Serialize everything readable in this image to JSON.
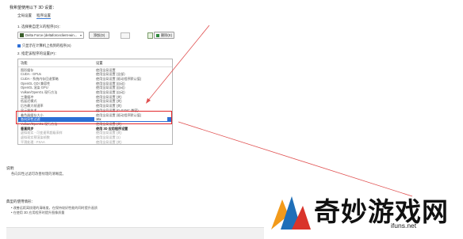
{
  "dialog": {
    "title": "我希望使用以下 3D 设置：",
    "tabs": [
      {
        "label": "全局设置"
      },
      {
        "label": "程序设置"
      }
    ],
    "step1_label": "1. 选择要自定义的程序(O)：",
    "program_value": "Delta Force (deltaforceclient-win...",
    "add_button": "添加(D)",
    "delete_button": "删除(E)",
    "checkbox_label": "只显示在计算机上找到的程序(S)",
    "step2_label": "2. 指定该程序的设置(P)：",
    "columns": {
      "feature": "功能",
      "setting": "设置"
    },
    "rows": [
      {
        "feature": "图形缓存",
        "setting": "使用全局设置"
      },
      {
        "feature": "CUDA - GPUs",
        "setting": "使用全局设置 (全部)"
      },
      {
        "feature": "CUDA - 系统内存回退策略",
        "setting": "使用全局设置 (驱动程序默认值)"
      },
      {
        "feature": "OpenGL GDI 兼容性",
        "setting": "使用全局设置 (自动)"
      },
      {
        "feature": "OpenGL 渲染 GPU",
        "setting": "使用全局设置 (自动)"
      },
      {
        "feature": "Vulkan/OpenGL 现行方法",
        "setting": "使用全局设置 (自动)"
      },
      {
        "feature": "三重缓冲",
        "setting": "使用全局设置 (关)"
      },
      {
        "feature": "低延迟模式",
        "setting": "使用全局设置 (关)"
      },
      {
        "feature": "后台最大帧速率",
        "setting": "使用全局设置 (关)"
      },
      {
        "feature": "显示器技术",
        "setting": "使用全局设置 (G-SYNC 兼容)"
      },
      {
        "feature": "着色器缓存大小",
        "setting": "使用全局设置 (驱动程序默认值)"
      },
      {
        "feature": "各向异性过滤",
        "setting": "16x"
      },
      {
        "feature": "Vulkan/OpenGL 现行方法",
        "setting": "使用全局设置 (关)"
      },
      {
        "feature": "垂直同步",
        "setting": "使用 3D 应用程序设置"
      },
      {
        "feature": "虚拟现实 - 可变速率超级采样",
        "setting": "使用全局设置 (关)"
      },
      {
        "feature": "虚拟现实预渲染帧数",
        "setting": "使用全局设置 (1)"
      },
      {
        "feature": "平滑处理 - FXAA",
        "setting": "使用全局设置 (关)"
      }
    ],
    "description_label": "说明:",
    "description_text": "各向异性过滤可改善纹理的清晰度。",
    "usage_label": "典型的使用情形：",
    "usage_items": [
      "• 改善远距离纹理的清晰度，在保持较好性能的同时提升画质",
      "• 在使用 3D 应用程序时提升图像质量"
    ]
  },
  "watermark": {
    "brand": "奇妙游戏网",
    "url": "ifuns.net",
    "colors": {
      "logo_orange": "#f29a1a",
      "logo_blue": "#1f6fb8",
      "logo_red": "#d9342b"
    }
  },
  "colors": {
    "highlight_row": "#2d6fd5",
    "annotation_red": "#e2272b",
    "arrow_red": "#e05050"
  }
}
